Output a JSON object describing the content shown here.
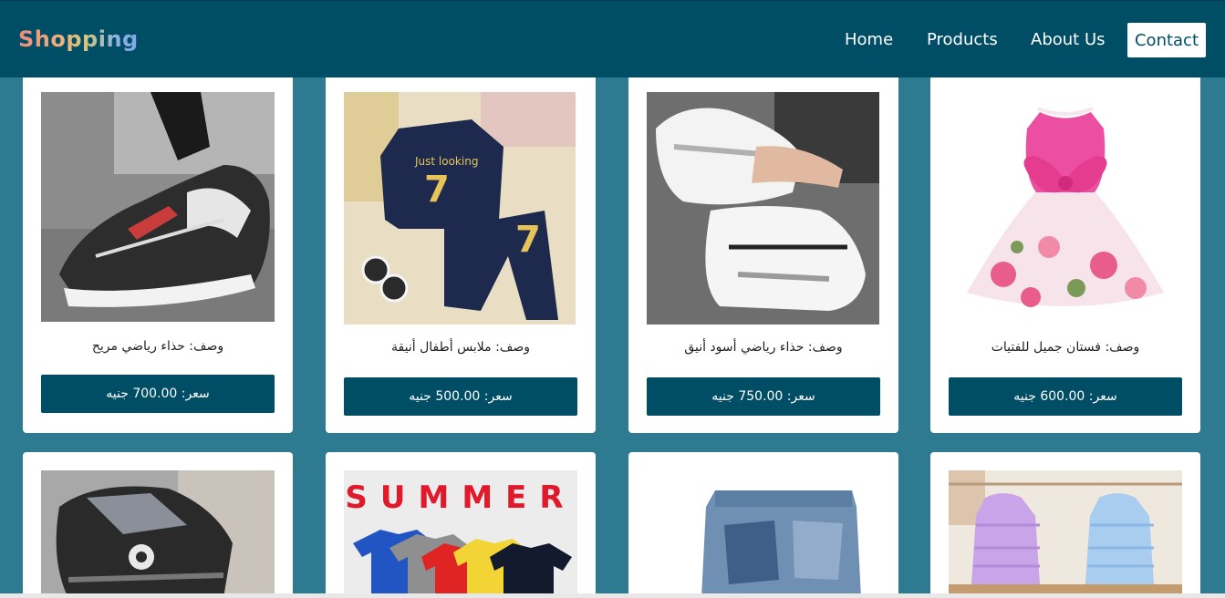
{
  "nav": {
    "brand": "Shopping",
    "items": [
      "Home",
      "Products",
      "About Us"
    ],
    "contact": "Contact"
  },
  "products": [
    {
      "desc": "وصف: حذاء رياضي مريح",
      "price": "سعر: 700.00 جنيه",
      "image": "black-white-sneaker-photo"
    },
    {
      "desc": "وصف: ملابس أطفال أنيقة",
      "price": "سعر: 500.00 جنيه",
      "image": "kids-navy-tracksuit-photo"
    },
    {
      "desc": "وصف: حذاء رياضي أسود أنيق",
      "price": "سعر: 750.00 جنيه",
      "image": "white-chunky-sneakers-photo"
    },
    {
      "desc": "وصف: فستان جميل للفتيات",
      "price": "سعر: 600.00 جنيه",
      "image": "pink-floral-girls-dress-photo"
    },
    {
      "image": "grey-black-kids-sneaker-photo"
    },
    {
      "image": "summer-tshirts-photo",
      "image_text": "SUMMER"
    },
    {
      "image": "denim-shorts-photo"
    },
    {
      "image": "kids-puffer-jackets-photo"
    }
  ],
  "colors": {
    "background": "#2e7a91",
    "navbar": "#004d66",
    "button": "#004d66"
  }
}
